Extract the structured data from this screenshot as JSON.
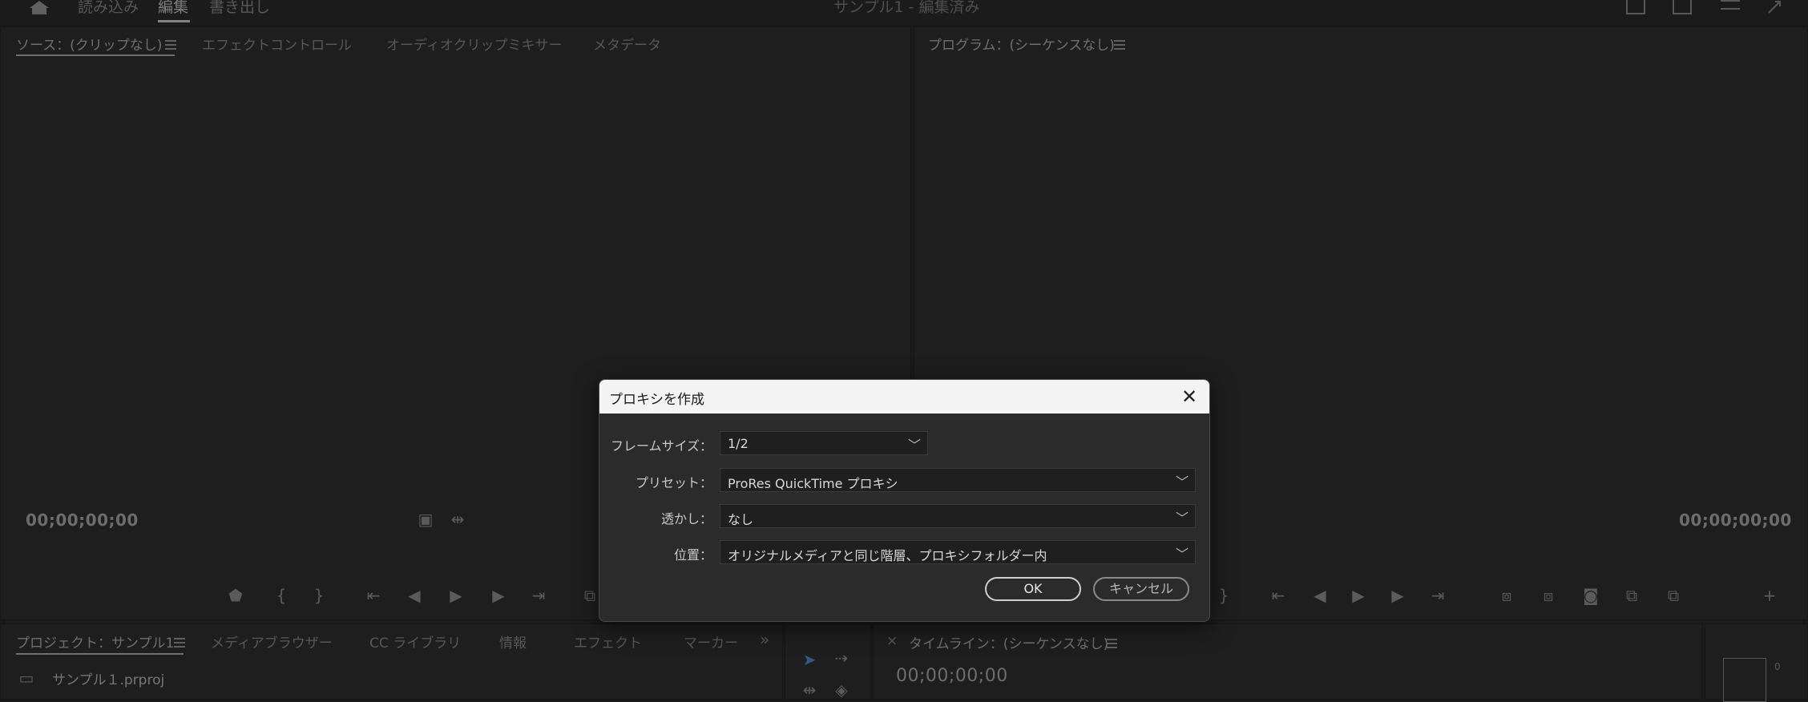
{
  "topbar": {
    "tabs": [
      "読み込み",
      "編集",
      "書き出し"
    ],
    "project_title": "サンプル1 - 編集済み",
    "icons": [
      "home-icon",
      "workspace-icon",
      "share-icon",
      "menu-icon",
      "fullscreen-icon"
    ]
  },
  "source_panel": {
    "tabs": [
      "ソース：(クリップなし)",
      "エフェクトコントロール",
      "オーディオクリップミキサー",
      "メタデータ"
    ],
    "timecode": "00;00;00;00"
  },
  "program_panel": {
    "tab": "プログラム：(シーケンスなし)",
    "timecode": "00;00;00;00"
  },
  "project_panel": {
    "tabs": [
      "プロジェクト：サンプル1",
      "メディアブラウザー",
      "CC ライブラリ",
      "情報",
      "エフェクト",
      "マーカー"
    ],
    "more": "»",
    "file": "サンプル１.prproj"
  },
  "timeline_panel": {
    "close": "×",
    "tab": "タイムライン：(シーケンスなし)",
    "timecode": "00;00;00;00"
  },
  "audio_meter": {
    "label": "0"
  },
  "dialog": {
    "title": "プロキシを作成",
    "close": "✕",
    "frame_size_label": "フレームサイズ：",
    "frame_size_value": "1/2",
    "preset_label": "プリセット：",
    "preset_value": "ProRes QuickTime プロキシ",
    "watermark_label": "透かし：",
    "watermark_value": "なし",
    "location_label": "位置：",
    "location_value": "オリジナルメディアと同じ階層、プロキシフォルダー内",
    "ok_label": "OK",
    "cancel_label": "キャンセル"
  }
}
